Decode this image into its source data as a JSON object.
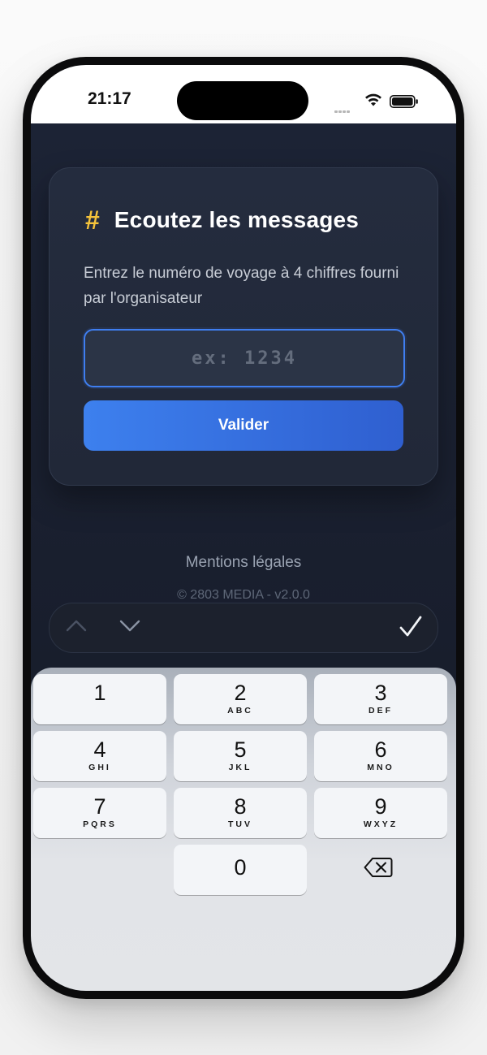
{
  "status": {
    "time": "21:17"
  },
  "card": {
    "icon": "#",
    "title": "Ecoutez les messages",
    "description": "Entrez le numéro de voyage à 4 chiffres fourni par l'organisateur",
    "input_value": "",
    "input_placeholder": "ex: 1234",
    "submit_label": "Valider"
  },
  "footer": {
    "legal": "Mentions légales",
    "copyright": "© 2803 MEDIA - v2.0.0"
  },
  "toolbar": {
    "prev_icon": "chevron-up-icon",
    "next_icon": "chevron-down-icon",
    "done_icon": "checkmark-icon"
  },
  "keypad": {
    "keys": [
      {
        "num": "1",
        "letters": ""
      },
      {
        "num": "2",
        "letters": "ABC"
      },
      {
        "num": "3",
        "letters": "DEF"
      },
      {
        "num": "4",
        "letters": "GHI"
      },
      {
        "num": "5",
        "letters": "JKL"
      },
      {
        "num": "6",
        "letters": "MNO"
      },
      {
        "num": "7",
        "letters": "PQRS"
      },
      {
        "num": "8",
        "letters": "TUV"
      },
      {
        "num": "9",
        "letters": "WXYZ"
      },
      {
        "num": "0",
        "letters": ""
      }
    ],
    "delete_icon": "backspace-icon"
  },
  "colors": {
    "accent": "#3d80ee",
    "hash": "#f5c33b",
    "background": "#1b2233"
  }
}
